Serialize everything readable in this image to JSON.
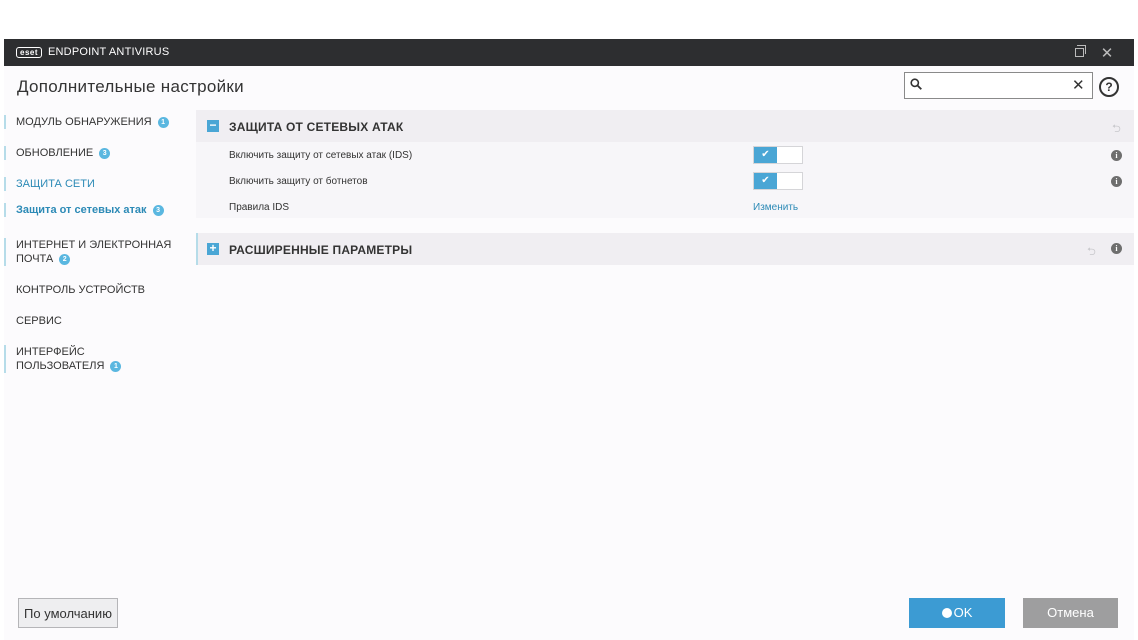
{
  "titlebar": {
    "logo": "eset",
    "title": "ENDPOINT ANTIVIRUS"
  },
  "page_title": "Дополнительные настройки",
  "search": {
    "value": "",
    "placeholder": ""
  },
  "sidebar": {
    "items": [
      {
        "label": "МОДУЛЬ ОБНАРУЖЕНИЯ",
        "badge": "1"
      },
      {
        "label": "ОБНОВЛЕНИЕ",
        "badge": "3"
      },
      {
        "label": "ЗАЩИТА СЕТИ",
        "badge": ""
      },
      {
        "label": "Защита от сетевых атак",
        "badge": "3"
      },
      {
        "label_line1": "ИНТЕРНЕТ И ЭЛЕКТРОННАЯ",
        "label_line2": "ПОЧТА",
        "badge": "2"
      },
      {
        "label": "КОНТРОЛЬ УСТРОЙСТВ",
        "badge": ""
      },
      {
        "label": "СЕРВИС",
        "badge": ""
      },
      {
        "label_line1": "ИНТЕРФЕЙС",
        "label_line2": "ПОЛЬЗОВАТЕЛЯ",
        "badge": "1"
      }
    ]
  },
  "sections": [
    {
      "title": "ЗАЩИТА ОТ СЕТЕВЫХ АТАК",
      "expanded": true,
      "rows": [
        {
          "label": "Включить защиту от сетевых атак (IDS)",
          "enabled": true
        },
        {
          "label": "Включить защиту от ботнетов",
          "enabled": true
        },
        {
          "label": "Правила IDS",
          "link": "Изменить"
        }
      ]
    },
    {
      "title": "РАСШИРЕННЫЕ ПАРАМЕТРЫ",
      "expanded": false
    }
  ],
  "buttons": {
    "default": "По умолчанию",
    "ok": "OK",
    "cancel": "Отмена"
  },
  "colors": {
    "accent": "#4aa6d5",
    "link": "#2c8ab6",
    "titlebar": "#2d2e30"
  }
}
